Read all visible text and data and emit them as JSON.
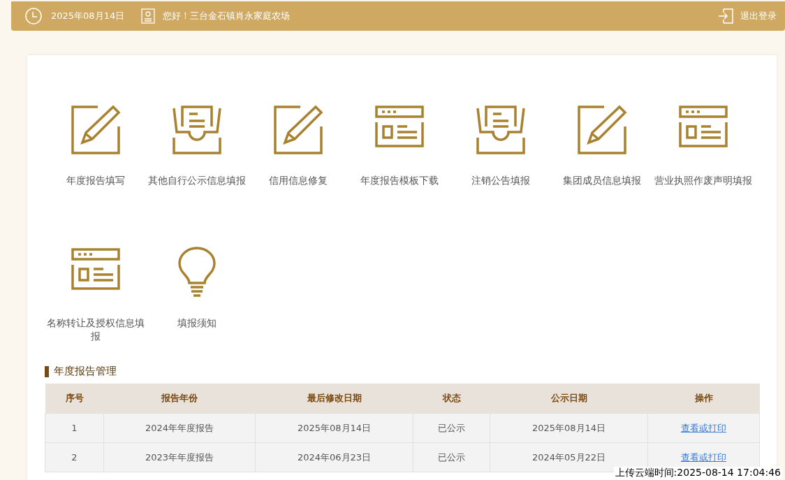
{
  "header": {
    "date": "2025年08月14日",
    "greeting": "您好！三台金石镇肖永家庭农场",
    "logout": "退出登录"
  },
  "menu": [
    {
      "label": "年度报告填写",
      "kind": "pencil"
    },
    {
      "label": "其他自行公示信息填报",
      "kind": "tray"
    },
    {
      "label": "信用信息修复",
      "kind": "pencil"
    },
    {
      "label": "年度报告模板下载",
      "kind": "webpage"
    },
    {
      "label": "注销公告填报",
      "kind": "tray"
    },
    {
      "label": "集团成员信息填报",
      "kind": "pencil"
    },
    {
      "label": "营业执照作废声明填报",
      "kind": "webpage"
    },
    {
      "label": "名称转让及授权信息填报",
      "kind": "webpage"
    },
    {
      "label": "填报须知",
      "kind": "bulb"
    }
  ],
  "section_title": "年度报告管理",
  "table": {
    "columns": [
      "序号",
      "报告年份",
      "最后修改日期",
      "状态",
      "公示日期",
      "操作"
    ],
    "rows": [
      {
        "cells": [
          "1",
          "2024年年度报告",
          "2025年08月14日",
          "已公示",
          "2025年08月14日"
        ],
        "action": "查看或打印"
      },
      {
        "cells": [
          "2",
          "2023年年度报告",
          "2024年06月23日",
          "已公示",
          "2024年05月22日"
        ],
        "action": "查看或打印"
      }
    ]
  },
  "upload_stamp": "上传云端时间:2025-08-14 17:04:46"
}
